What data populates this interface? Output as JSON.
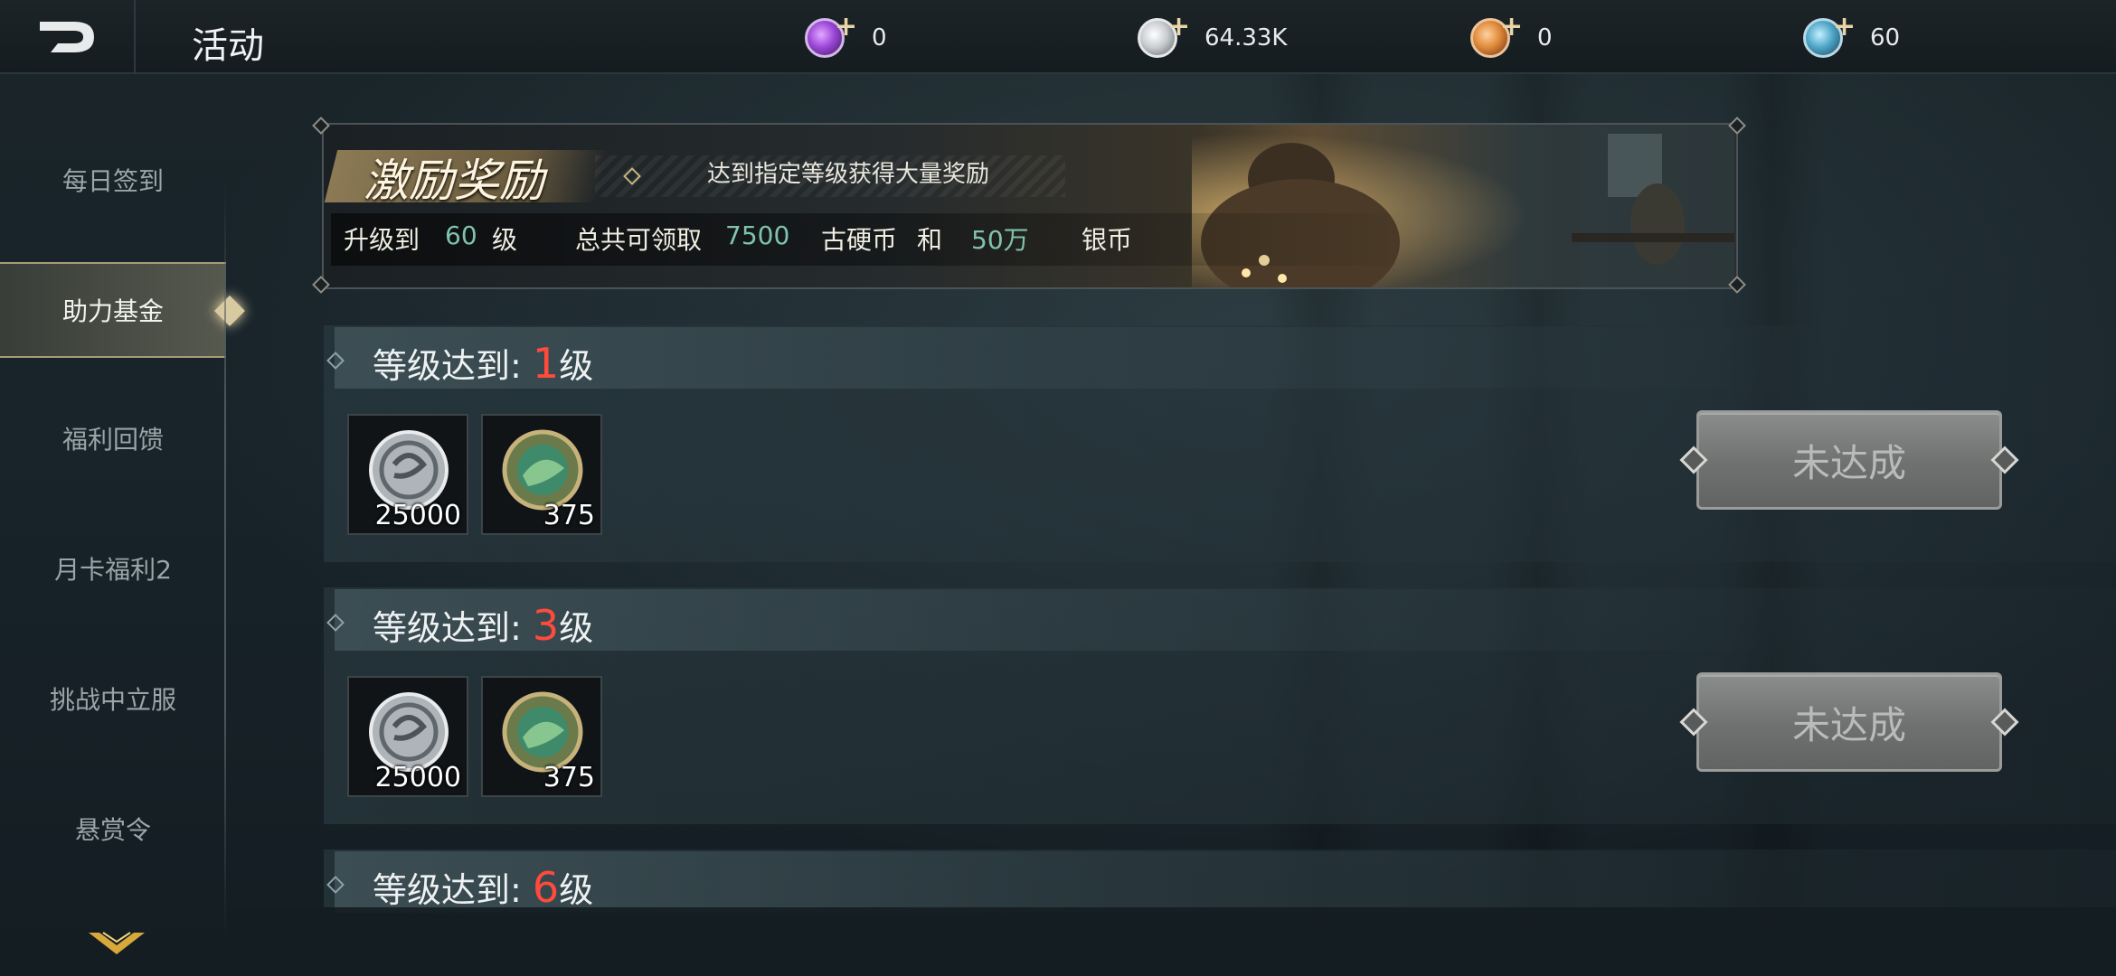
{
  "header": {
    "title": "活动",
    "currencies": [
      {
        "icon": "purple-gem-icon",
        "value": "0",
        "color": "#9b46d8"
      },
      {
        "icon": "silver-coin-icon",
        "value": "64.33K",
        "color": "#c9cdd0"
      },
      {
        "icon": "orange-coin-icon",
        "value": "0",
        "color": "#e08a3a"
      },
      {
        "icon": "teal-gem-icon",
        "value": "60",
        "color": "#4fa6c8"
      }
    ]
  },
  "sidebar": {
    "items": [
      {
        "label": "每日签到"
      },
      {
        "label": "助力基金",
        "active": true
      },
      {
        "label": "福利回馈"
      },
      {
        "label": "月卡福利2"
      },
      {
        "label": "挑战中立服"
      },
      {
        "label": "悬赏令"
      }
    ]
  },
  "banner": {
    "title": "激励奖励",
    "subtitle": "达到指定等级获得大量奖励",
    "upgrade_prefix": "升级到",
    "level": "60",
    "level_suffix": "级",
    "total_prefix": "总共可领取",
    "coin_amount": "7500",
    "coin_name": "古硬币",
    "and": "和",
    "silver_amount": "50万",
    "silver_name": "银币"
  },
  "levels": [
    {
      "prefix": "等级达到:",
      "num": "1",
      "suffix": "级",
      "rewards": [
        {
          "icon": "silver-coin-icon",
          "count": "25000"
        },
        {
          "icon": "ancient-coin-icon",
          "count": "375"
        }
      ],
      "button": "未达成"
    },
    {
      "prefix": "等级达到:",
      "num": "3",
      "suffix": "级",
      "rewards": [
        {
          "icon": "silver-coin-icon",
          "count": "25000"
        },
        {
          "icon": "ancient-coin-icon",
          "count": "375"
        }
      ],
      "button": "未达成"
    },
    {
      "prefix": "等级达到:",
      "num": "6",
      "suffix": "级"
    }
  ],
  "colors": {
    "accent_red": "#ff4a3d",
    "accent_green": "#7fc3ad",
    "gold": "#c5b682"
  }
}
